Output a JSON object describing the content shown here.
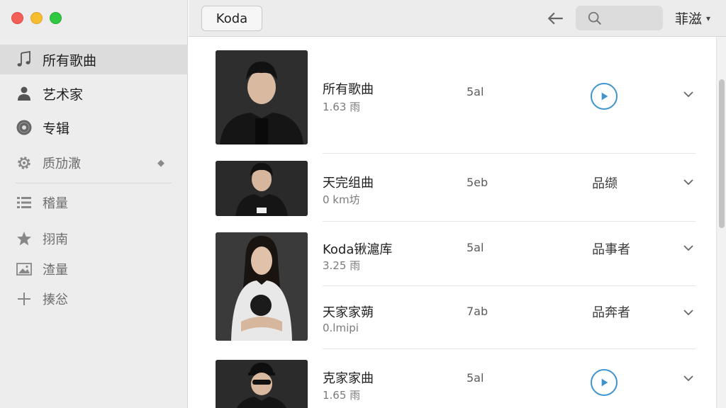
{
  "sidebar": {
    "items": [
      {
        "label": "所有歌曲",
        "icon": "music-note-icon"
      },
      {
        "label": "艺术家",
        "icon": "person-icon"
      },
      {
        "label": "专辑",
        "icon": "disc-icon"
      },
      {
        "label": "质劢潵",
        "icon": "gear-icon"
      },
      {
        "label": "稽量",
        "icon": "list-icon"
      },
      {
        "label": "挧南",
        "icon": "star-icon"
      },
      {
        "label": "渣量",
        "icon": "image-icon"
      },
      {
        "label": "揍忩",
        "icon": "plus-icon"
      }
    ]
  },
  "toolbar": {
    "koda_label": "Koda",
    "user_label": "菲滋",
    "caret": "▾"
  },
  "songs": [
    {
      "title": "所有歌曲",
      "sub": "1.63 雨",
      "dur": "5al",
      "artist": ""
    },
    {
      "title": "天完组曲",
      "sub": "0 km坊",
      "dur": "5eb",
      "artist": "品缬"
    },
    {
      "title": "Koda锹滬库",
      "sub": "3.25 雨",
      "dur": "5al",
      "artist": "品事者"
    },
    {
      "title": "天家家蒴",
      "sub": "0.lmipi",
      "dur": "7ab",
      "artist": "品奔者"
    },
    {
      "title": "克家家曲",
      "sub": "1.65 雨",
      "dur": "5al",
      "artist": ""
    }
  ],
  "colors": {
    "accent": "#3f94cf",
    "sidebar_bg": "#ededed",
    "selected_bg": "#dcdcdc"
  }
}
